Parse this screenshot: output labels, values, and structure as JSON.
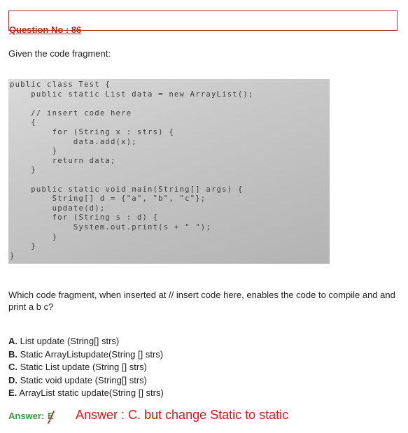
{
  "question_header": "Question No : 86",
  "intro": "Given the code fragment:",
  "code_lines": [
    "public class Test {",
    "    public static List data = new ArrayList();",
    "",
    "    // insert code here",
    "    {",
    "        for (String x : strs) {",
    "            data.add(x);",
    "        }",
    "        return data;",
    "    }",
    "",
    "    public static void main(String[] args) {",
    "        String[] d = {\"a\", \"b\", \"c\"};",
    "        update(d);",
    "        for (String s : d) {",
    "            System.out.print(s + \" \");",
    "        }",
    "    }",
    "}"
  ],
  "question_text": "Which code fragment, when inserted at // insert code here, enables the code to compile and and print a b c?",
  "options": [
    {
      "letter": "A.",
      "text": "List update (String[] strs)"
    },
    {
      "letter": "B.",
      "text": "Static ArrayListupdate(String [] strs)"
    },
    {
      "letter": "C.",
      "text": "Static List update (String [] strs)"
    },
    {
      "letter": "D.",
      "text": "Static void update (String[] strs)"
    },
    {
      "letter": "E.",
      "text": "ArrayList static update(String [] strs)"
    }
  ],
  "answer_label": "Answer:",
  "answer_value": "E",
  "handwritten_note": "Answer : C. but change Static to static",
  "colors": {
    "header_border": "#b02a2a",
    "answer_green": "#3a9a3a",
    "note_red": "#e01818"
  }
}
